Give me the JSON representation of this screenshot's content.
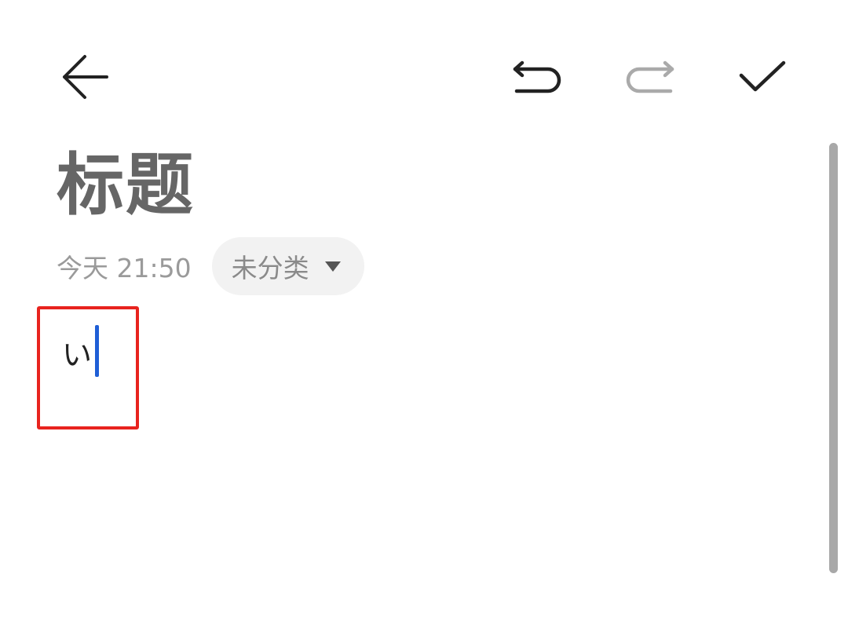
{
  "toolbar": {
    "back_icon": "arrow-left-icon",
    "undo_icon": "undo-icon",
    "redo_icon": "redo-icon",
    "done_icon": "check-icon",
    "icon_color": "#222222",
    "disabled_icon_color": "#aaaaaa"
  },
  "note": {
    "title": "标题",
    "timestamp": "今天 21:50",
    "category": "未分类",
    "category_icon": "triangle-down-icon",
    "body_text": "い"
  },
  "colors": {
    "cursor": "#1f5fd6",
    "highlight_box": "#e8231e",
    "title_text": "#666666"
  }
}
